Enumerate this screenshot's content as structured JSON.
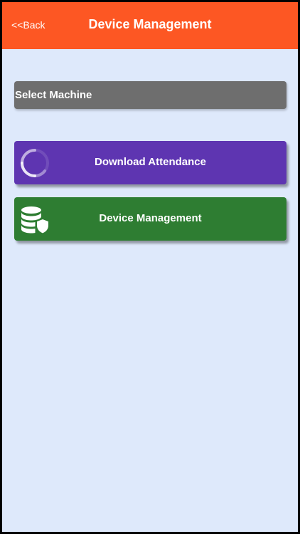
{
  "header": {
    "back_label": "<<Back",
    "title": "Device Management"
  },
  "select_machine": {
    "label": "Select Machine"
  },
  "buttons": [
    {
      "label": "Download Attendance",
      "icon": "loading-spinner-icon",
      "color": "#5e35b1"
    },
    {
      "label": "Device Management",
      "icon": "database-shield-icon",
      "color": "#2e7d32"
    }
  ],
  "colors": {
    "header": "#fd5723",
    "background": "#dee9fb",
    "select": "#6e6e6e"
  }
}
